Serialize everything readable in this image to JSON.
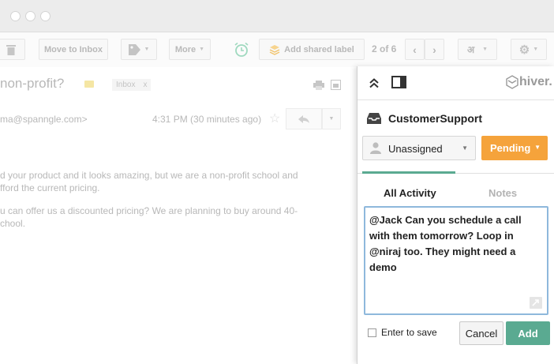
{
  "toolbar": {
    "move_to_inbox": "Move to Inbox",
    "more": "More",
    "add_shared_label": "Add shared label",
    "pagination": "2 of 6",
    "lang": "अ"
  },
  "email": {
    "subject": "non-profit?",
    "label_chip": "Inbox",
    "label_chip_close": "x",
    "sender_email": "ma@spanngle.com>",
    "time": "4:31 PM (30 minutes ago)",
    "body_lines": [
      "d your product and it looks amazing, but we are a non-profit school and",
      "fford the current pricing.",
      "u can offer us a discounted pricing? We are planning to buy around 40-",
      "chool."
    ]
  },
  "panel": {
    "brand": "hiver.",
    "mailbox_name": "CustomerSupport",
    "assignee": "Unassigned",
    "status": "Pending",
    "tabs": [
      "All Activity",
      "Notes"
    ],
    "note_text": "@Jack Can you schedule a call with them tomorrow? Loop in @niraj too. They might need a demo",
    "enter_to_save": "Enter to save",
    "cancel": "Cancel",
    "add": "Add"
  },
  "colors": {
    "accent_orange": "#f5a33b",
    "accent_green": "#5aaa91",
    "focus_blue": "#8eb8dc"
  },
  "icons": [
    "trash-icon",
    "tag-icon",
    "snooze-alarm-icon",
    "shared-label-icon",
    "chevron-left-icon",
    "chevron-right-icon",
    "gear-icon",
    "print-icon",
    "open-new-window-icon",
    "star-icon",
    "reply-icon",
    "collapse-icon",
    "sidebar-toggle-icon",
    "hiver-logo-icon",
    "inbox-icon",
    "user-icon",
    "expand-icon"
  ]
}
